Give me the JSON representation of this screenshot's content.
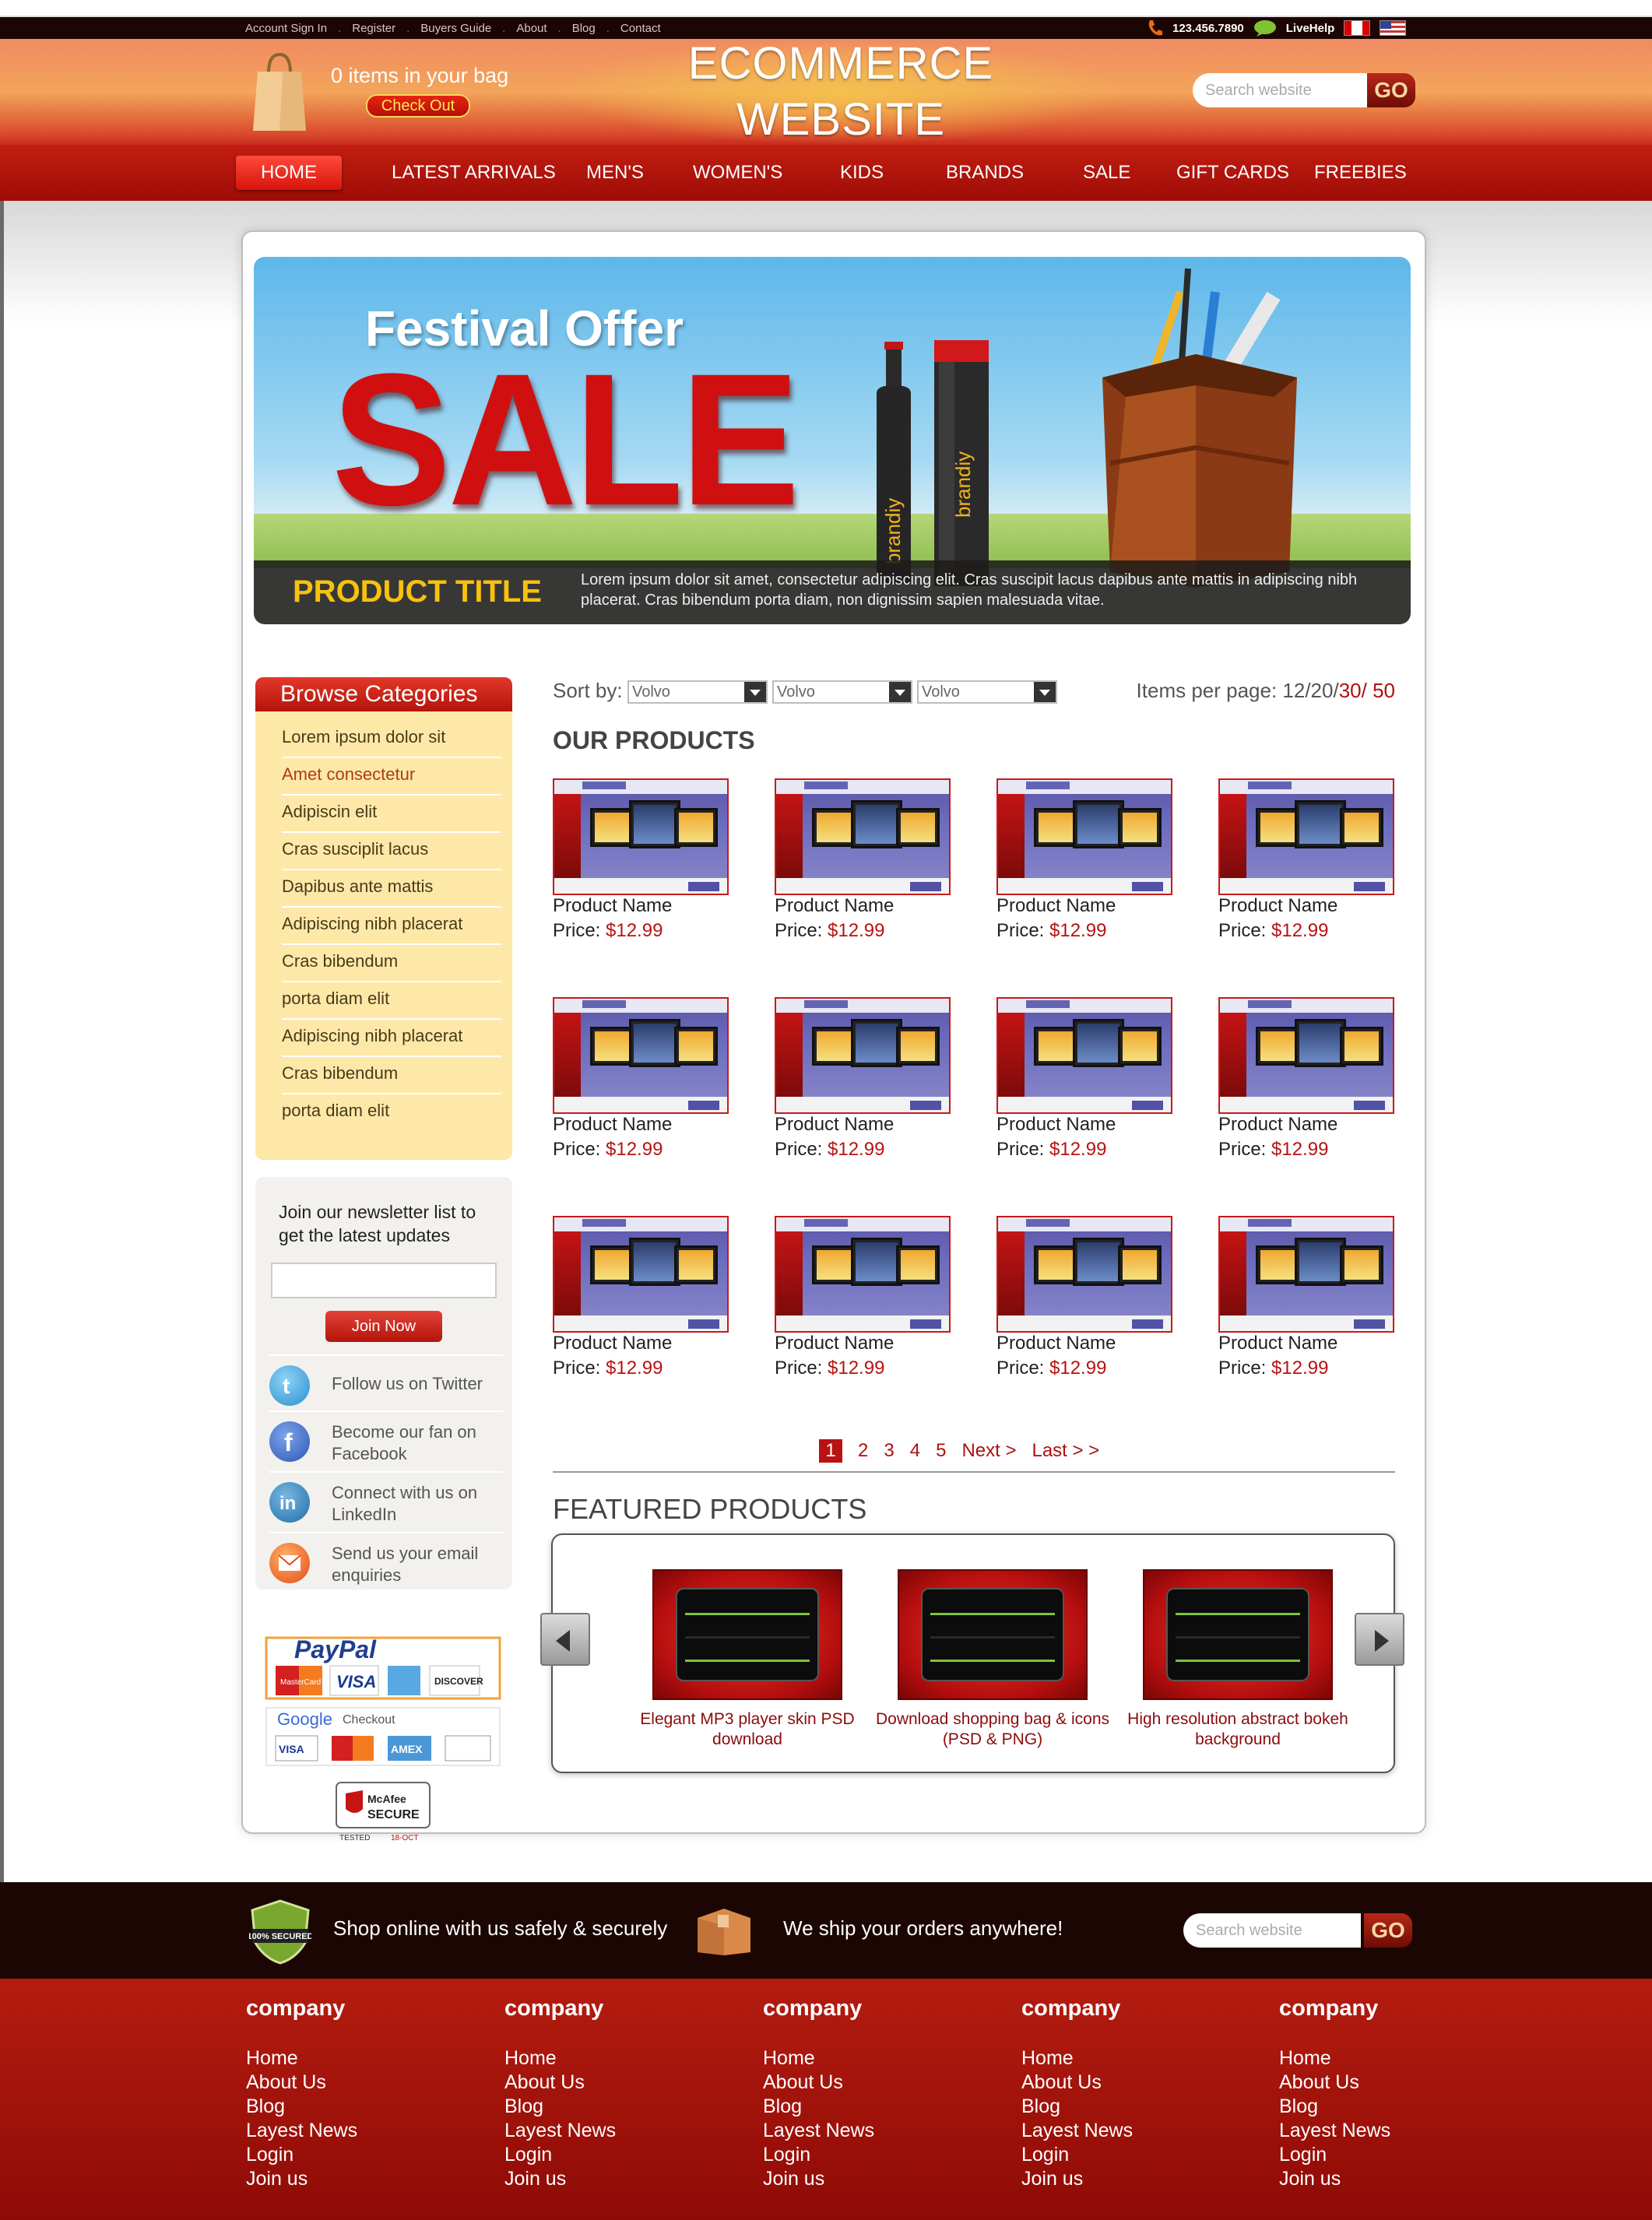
{
  "toplinks": [
    "Account Sign In",
    "Register",
    "Buyers Guide",
    "About",
    "Blog",
    "Contact"
  ],
  "phone": "123.456.7890",
  "livehelp": "LiveHelp",
  "bag_text": "0 items in your bag",
  "checkout_label": "Check Out",
  "logo_line1": "ECOMMERCE",
  "logo_line2": "WEBSITE",
  "search_placeholder": "Search website",
  "search_go": "GO",
  "nav": [
    "HOME",
    "LATEST ARRIVALS",
    "MEN'S",
    "WOMEN'S",
    "KIDS",
    "BRANDS",
    "SALE",
    "GIFT CARDS",
    "FREEBIES"
  ],
  "banner": {
    "headline": "Festival Offer",
    "sale": "SALE",
    "bottle_label": "brandiy",
    "product_title": "PRODUCT TITLE",
    "description": "Lorem ipsum dolor sit amet, consectetur adipiscing elit. Cras suscipit lacus dapibus ante mattis in adipiscing nibh placerat. Cras bibendum porta diam, non dignissim sapien malesuada vitae."
  },
  "categories": {
    "title": "Browse Categories",
    "items": [
      "Lorem ipsum dolor sit",
      "Amet consectetur",
      "Adipiscin elit",
      "Cras susciplit lacus",
      "Dapibus ante mattis",
      "Adipiscing nibh placerat",
      "Cras bibendum",
      "porta diam elit",
      "Adipiscing nibh placerat",
      "Cras bibendum",
      "porta diam elit"
    ]
  },
  "newsletter": {
    "text": "Join our newsletter list to get the latest updates",
    "button": "Join Now",
    "social": [
      "Follow us on Twitter",
      "Become our fan on Facebook",
      "Connect with us on LinkedIn",
      "Send us your email enquiries"
    ]
  },
  "payments": {
    "paypal": "PayPal",
    "google": "Google",
    "checkout": "Checkout",
    "cards": [
      "MasterCard",
      "VISA",
      "AMEX",
      "DISCOVER"
    ],
    "mcafee_1": "McAfee",
    "mcafee_2": "SECURE",
    "tested": "TESTED",
    "date": "18-OCT"
  },
  "sort": {
    "label": "Sort by:",
    "options": [
      "Volvo",
      "Volvo",
      "Volvo"
    ],
    "ipp_label": "Items per page: 12/20/",
    "ipp_30": "30",
    "ipp_50": "/ 50"
  },
  "our_products_title": "OUR PRODUCTS",
  "product_name": "Product Name",
  "price_label": "Price: ",
  "price_value": "$12.99",
  "thumb_brand": "Corporatis",
  "pager": {
    "current": "1",
    "pages": [
      "2",
      "3",
      "4",
      "5"
    ],
    "next": "Next >",
    "last": "Last > >"
  },
  "featured_title": "FEATURED PRODUCTS",
  "featured_items": [
    "Elegant MP3 player skin PSD download",
    "Download shopping bag & icons (PSD & PNG)",
    "High resolution abstract bokeh background"
  ],
  "footer_strip": {
    "secured": "100% SECURED",
    "shop": "Shop online with us safely & securely",
    "ship": "We ship your orders anywhere!"
  },
  "footer_cols": [
    {
      "title": "company",
      "links": [
        "Home",
        "About Us",
        "Blog",
        "Layest News",
        "Login",
        "Join us"
      ]
    },
    {
      "title": "company",
      "links": [
        "Home",
        "About Us",
        "Blog",
        "Layest News",
        "Login",
        "Join us"
      ]
    },
    {
      "title": "company",
      "links": [
        "Home",
        "About Us",
        "Blog",
        "Layest News",
        "Login",
        "Join us"
      ]
    },
    {
      "title": "company",
      "links": [
        "Home",
        "About Us",
        "Blog",
        "Layest News",
        "Login",
        "Join us"
      ]
    },
    {
      "title": "company",
      "links": [
        "Home",
        "About Us",
        "Blog",
        "Layest News",
        "Login",
        "Join us"
      ]
    }
  ],
  "colors": {
    "accent": "#b81212",
    "gold": "#f7c10e",
    "nav_red": "#c21e12",
    "footer_dark": "#1c0604"
  }
}
